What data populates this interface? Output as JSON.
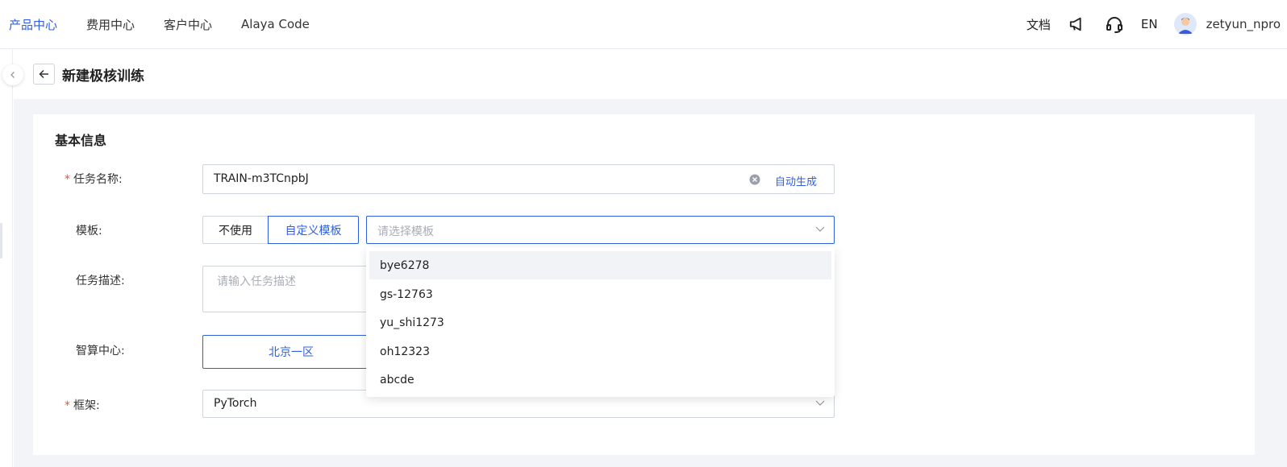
{
  "nav": {
    "items": [
      {
        "label": "产品中心",
        "active": true
      },
      {
        "label": "费用中心",
        "active": false
      },
      {
        "label": "客户中心",
        "active": false
      },
      {
        "label": "Alaya Code",
        "active": false
      }
    ],
    "right": {
      "docs": "文档",
      "lang": "EN",
      "username": "zetyun_npro",
      "icons": [
        "megaphone-icon",
        "headset-icon",
        "avatar"
      ]
    }
  },
  "page": {
    "title": "新建极核训练"
  },
  "form": {
    "section_title": "基本信息",
    "task_name": {
      "label": "任务名称:",
      "required": true,
      "value": "TRAIN-m3TCnpbJ",
      "auto_generate": "自动生成"
    },
    "template": {
      "label": "模板:",
      "options": [
        "不使用",
        "自定义模板"
      ],
      "selected": "自定义模板",
      "select_placeholder": "请选择模板",
      "dropdown_items": [
        "bye6278",
        "gs-12763",
        "yu_shi1273",
        "oh12323",
        "abcde"
      ],
      "hovered_item": "bye6278"
    },
    "description": {
      "label": "任务描述:",
      "placeholder": "请输入任务描述"
    },
    "compute_center": {
      "label": "智算中心:",
      "selected": "北京一区"
    },
    "framework": {
      "label": "框架:",
      "required": true,
      "value": "PyTorch"
    }
  },
  "colors": {
    "accent": "#2f5fe0",
    "required": "#e8553d",
    "page_bg": "#f2f4f8"
  }
}
